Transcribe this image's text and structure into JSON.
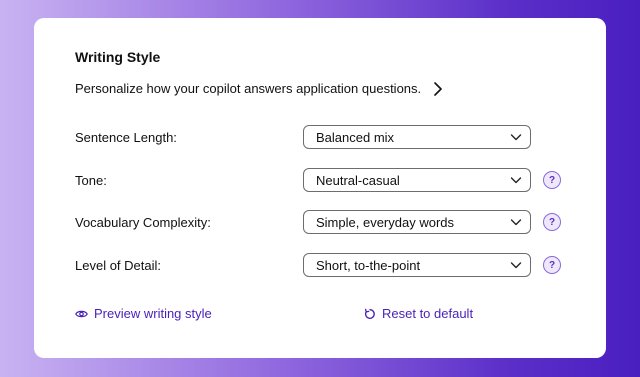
{
  "writing_style": {
    "title": "Writing Style",
    "subtitle": "Personalize how your copilot answers application questions.",
    "settings": [
      {
        "label": "Sentence Length:",
        "value": "Balanced mix",
        "has_help": false
      },
      {
        "label": "Tone:",
        "value": "Neutral-casual",
        "has_help": true
      },
      {
        "label": "Vocabulary Complexity:",
        "value": "Simple, everyday words",
        "has_help": true
      },
      {
        "label": "Level of Detail:",
        "value": "Short, to-the-point",
        "has_help": true
      }
    ],
    "help_glyph": "?",
    "actions": {
      "preview_label": "Preview writing style",
      "reset_label": "Reset to default"
    }
  },
  "colors": {
    "accent": "#4a1fb8",
    "help_bg": "#efe8fb"
  }
}
